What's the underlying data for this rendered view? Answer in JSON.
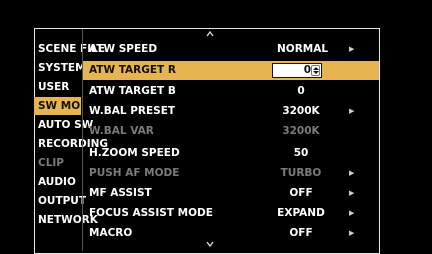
{
  "sidebar": {
    "items": [
      {
        "label": "SCENE FILE",
        "state": "normal"
      },
      {
        "label": "SYSTEM",
        "state": "normal"
      },
      {
        "label": "USER",
        "state": "normal"
      },
      {
        "label": "SW MODE",
        "state": "selected"
      },
      {
        "label": "AUTO SW",
        "state": "normal"
      },
      {
        "label": "RECORDING",
        "state": "normal"
      },
      {
        "label": "CLIP",
        "state": "disabled"
      },
      {
        "label": "AUDIO",
        "state": "normal"
      },
      {
        "label": "OUTPUT",
        "state": "normal"
      },
      {
        "label": "NETWORK",
        "state": "normal"
      }
    ]
  },
  "menu": {
    "rows": [
      {
        "label": "ATW SPEED",
        "value": "NORMAL",
        "has_arrow": true,
        "state": "normal"
      },
      {
        "label": "ATW TARGET R",
        "value": "0",
        "has_arrow": false,
        "state": "editing"
      },
      {
        "label": "ATW TARGET B",
        "value": "0",
        "has_arrow": false,
        "state": "normal"
      },
      {
        "label": "W.BAL PRESET",
        "value": "3200K",
        "has_arrow": true,
        "state": "normal"
      },
      {
        "label": "W.BAL VAR",
        "value": "3200K",
        "has_arrow": false,
        "state": "disabled"
      },
      {
        "label": "H.ZOOM SPEED",
        "value": "50",
        "has_arrow": false,
        "state": "normal"
      },
      {
        "label": "PUSH AF MODE",
        "value": "TURBO",
        "has_arrow": true,
        "state": "disabled"
      },
      {
        "label": "MF ASSIST",
        "value": "OFF",
        "has_arrow": true,
        "state": "normal"
      },
      {
        "label": "FOCUS ASSIST MODE",
        "value": "EXPAND",
        "has_arrow": true,
        "state": "normal"
      },
      {
        "label": "MACRO",
        "value": "OFF",
        "has_arrow": true,
        "state": "normal"
      }
    ]
  },
  "icons": {
    "scroll_up": "chevron-up-icon",
    "scroll_down": "chevron-down-icon",
    "submenu": "triangle-right-icon",
    "spinner": "up-down-spinner-icon"
  },
  "colors": {
    "highlight": "#e6b450",
    "background": "#000000",
    "text": "#ffffff",
    "disabled_text": "#7a7a7a"
  }
}
